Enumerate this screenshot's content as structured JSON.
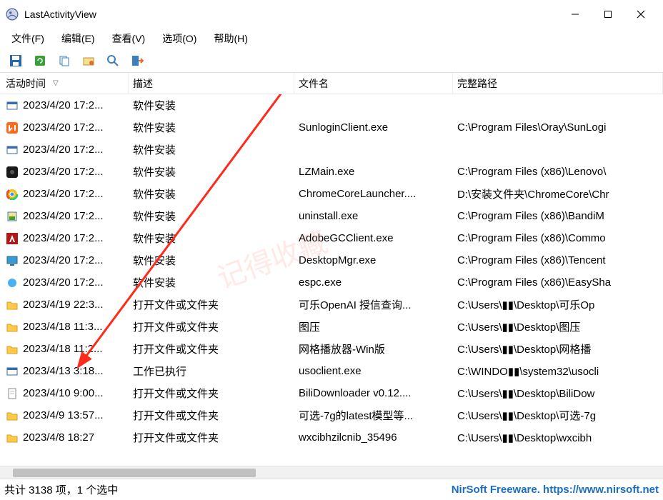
{
  "window": {
    "title": "LastActivityView"
  },
  "menu": {
    "file": "文件(F)",
    "edit": "编辑(E)",
    "view": "查看(V)",
    "options": "选项(O)",
    "help": "帮助(H)"
  },
  "columns": {
    "time": "活动时间",
    "desc": "描述",
    "file": "文件名",
    "path": "完整路径"
  },
  "rows": [
    {
      "icon": "installer",
      "time": "2023/4/20 17:2...",
      "desc": "软件安装",
      "file": "",
      "path": ""
    },
    {
      "icon": "orange-app",
      "time": "2023/4/20 17:2...",
      "desc": "软件安装",
      "file": "SunloginClient.exe",
      "path": "C:\\Program Files\\Oray\\SunLogi"
    },
    {
      "icon": "installer",
      "time": "2023/4/20 17:2...",
      "desc": "软件安装",
      "file": "",
      "path": ""
    },
    {
      "icon": "black-app",
      "time": "2023/4/20 17:2...",
      "desc": "软件安装",
      "file": "LZMain.exe",
      "path": "C:\\Program Files (x86)\\Lenovo\\"
    },
    {
      "icon": "chrome",
      "time": "2023/4/20 17:2...",
      "desc": "软件安装",
      "file": "ChromeCoreLauncher....",
      "path": "D:\\安装文件夹\\ChromeCore\\Chr"
    },
    {
      "icon": "install-wiz",
      "time": "2023/4/20 17:2...",
      "desc": "软件安装",
      "file": "uninstall.exe",
      "path": "C:\\Program Files (x86)\\BandiM"
    },
    {
      "icon": "adobe",
      "time": "2023/4/20 17:2...",
      "desc": "软件安装",
      "file": "AdobeGCClient.exe",
      "path": "C:\\Program Files (x86)\\Commo"
    },
    {
      "icon": "desktop",
      "time": "2023/4/20 17:2...",
      "desc": "软件安装",
      "file": "DesktopMgr.exe",
      "path": "C:\\Program Files (x86)\\Tencent"
    },
    {
      "icon": "blue-circle",
      "time": "2023/4/20 17:2...",
      "desc": "软件安装",
      "file": "espc.exe",
      "path": "C:\\Program Files (x86)\\EasySha"
    },
    {
      "icon": "folder",
      "time": "2023/4/19 22:3...",
      "desc": "打开文件或文件夹",
      "file": "可乐OpenAI 授信查询...",
      "path": "C:\\Users\\▮▮\\Desktop\\可乐Op"
    },
    {
      "icon": "folder",
      "time": "2023/4/18 11:3...",
      "desc": "打开文件或文件夹",
      "file": "图压",
      "path": "C:\\Users\\▮▮\\Desktop\\图压"
    },
    {
      "icon": "folder",
      "time": "2023/4/18 11:2...",
      "desc": "打开文件或文件夹",
      "file": "网格播放器-Win版",
      "path": "C:\\Users\\▮▮\\Desktop\\网格播"
    },
    {
      "icon": "installer",
      "time": "2023/4/13 3:18...",
      "desc": "工作已执行",
      "file": "usoclient.exe",
      "path": "C:\\WINDO▮▮\\system32\\usocli"
    },
    {
      "icon": "doc",
      "time": "2023/4/10 9:00...",
      "desc": "打开文件或文件夹",
      "file": "BiliDownloader v0.12....",
      "path": "C:\\Users\\▮▮\\Desktop\\BiliDow"
    },
    {
      "icon": "folder",
      "time": "2023/4/9 13:57...",
      "desc": "打开文件或文件夹",
      "file": "可选-7g的latest模型等...",
      "path": "C:\\Users\\▮▮\\Desktop\\可选-7g"
    },
    {
      "icon": "folder",
      "time": "2023/4/8 18:27",
      "desc": "打开文件或文件夹",
      "file": "wxcibhzilcnib_35496",
      "path": "C:\\Users\\▮▮\\Desktop\\wxcibh"
    }
  ],
  "status": {
    "left": "共计 3138 项，1 个选中",
    "right": "NirSoft Freeware. https://www.nirsoft.net"
  },
  "watermark": "记得收藏"
}
